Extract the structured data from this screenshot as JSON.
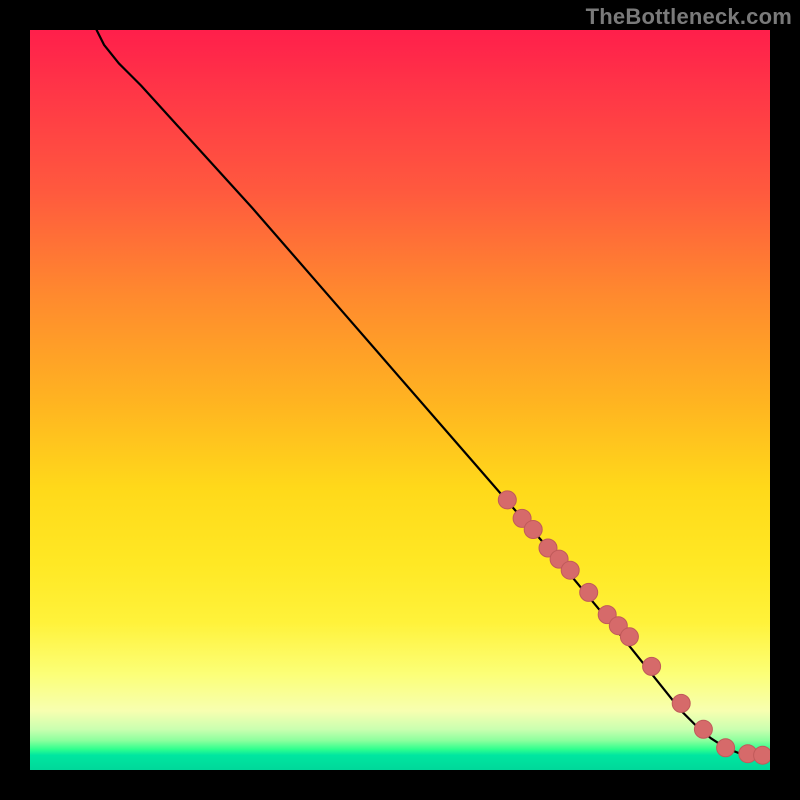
{
  "watermark": "TheBottleneck.com",
  "colors": {
    "curve": "#000000",
    "marker_fill": "#d66a6a",
    "marker_stroke": "#c05a5a"
  },
  "chart_data": {
    "type": "line",
    "title": "",
    "xlabel": "",
    "ylabel": "",
    "xlim": [
      0,
      100
    ],
    "ylim": [
      0,
      100
    ],
    "curve": {
      "x": [
        9,
        10,
        12,
        15,
        20,
        30,
        40,
        50,
        60,
        70,
        75,
        80,
        84,
        88,
        90,
        92,
        94,
        96,
        98,
        99
      ],
      "y": [
        100,
        98,
        95.5,
        92.5,
        87,
        76,
        64.5,
        53,
        41.5,
        30,
        24,
        18,
        13,
        8,
        6,
        4.3,
        3,
        2.2,
        2,
        2
      ]
    },
    "series": [
      {
        "name": "markers",
        "x": [
          64.5,
          66.5,
          68,
          70,
          71.5,
          73,
          75.5,
          78,
          79.5,
          81,
          84,
          88,
          91,
          94,
          97,
          99
        ],
        "y": [
          36.5,
          34,
          32.5,
          30,
          28.5,
          27,
          24,
          21,
          19.5,
          18,
          14,
          9,
          5.5,
          3,
          2.2,
          2
        ]
      }
    ]
  }
}
